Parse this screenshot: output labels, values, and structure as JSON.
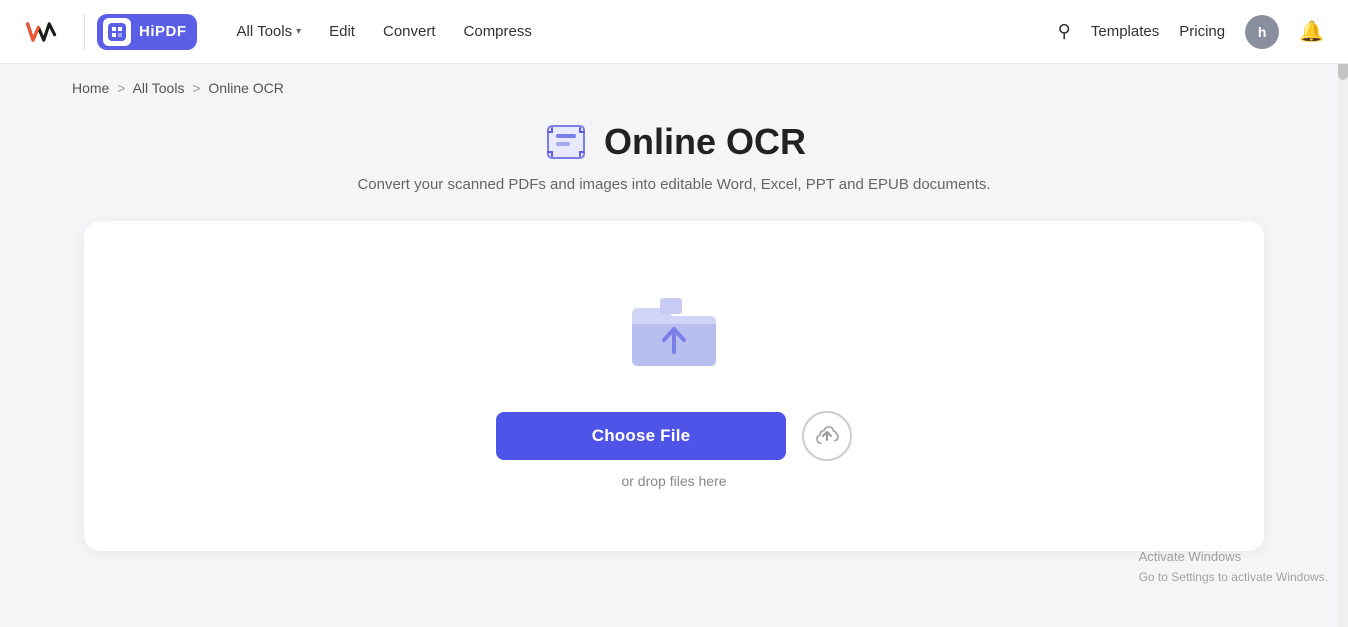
{
  "brand": {
    "wondershare_alt": "Wondershare",
    "hipdf_label": "HiPDF"
  },
  "navbar": {
    "all_tools_label": "All Tools",
    "edit_label": "Edit",
    "convert_label": "Convert",
    "compress_label": "Compress",
    "templates_label": "Templates",
    "pricing_label": "Pricing",
    "avatar_letter": "h",
    "search_placeholder": "Search"
  },
  "breadcrumb": {
    "home": "Home",
    "sep1": ">",
    "all_tools": "All Tools",
    "sep2": ">",
    "current": "Online OCR"
  },
  "page": {
    "title": "Online OCR",
    "subtitle": "Convert your scanned PDFs and images into editable Word, Excel, PPT and EPUB documents."
  },
  "upload": {
    "choose_file_label": "Choose File",
    "drop_hint": "or drop files here"
  },
  "activate": {
    "title": "Activate Windows",
    "subtitle": "Go to Settings to activate Windows."
  }
}
